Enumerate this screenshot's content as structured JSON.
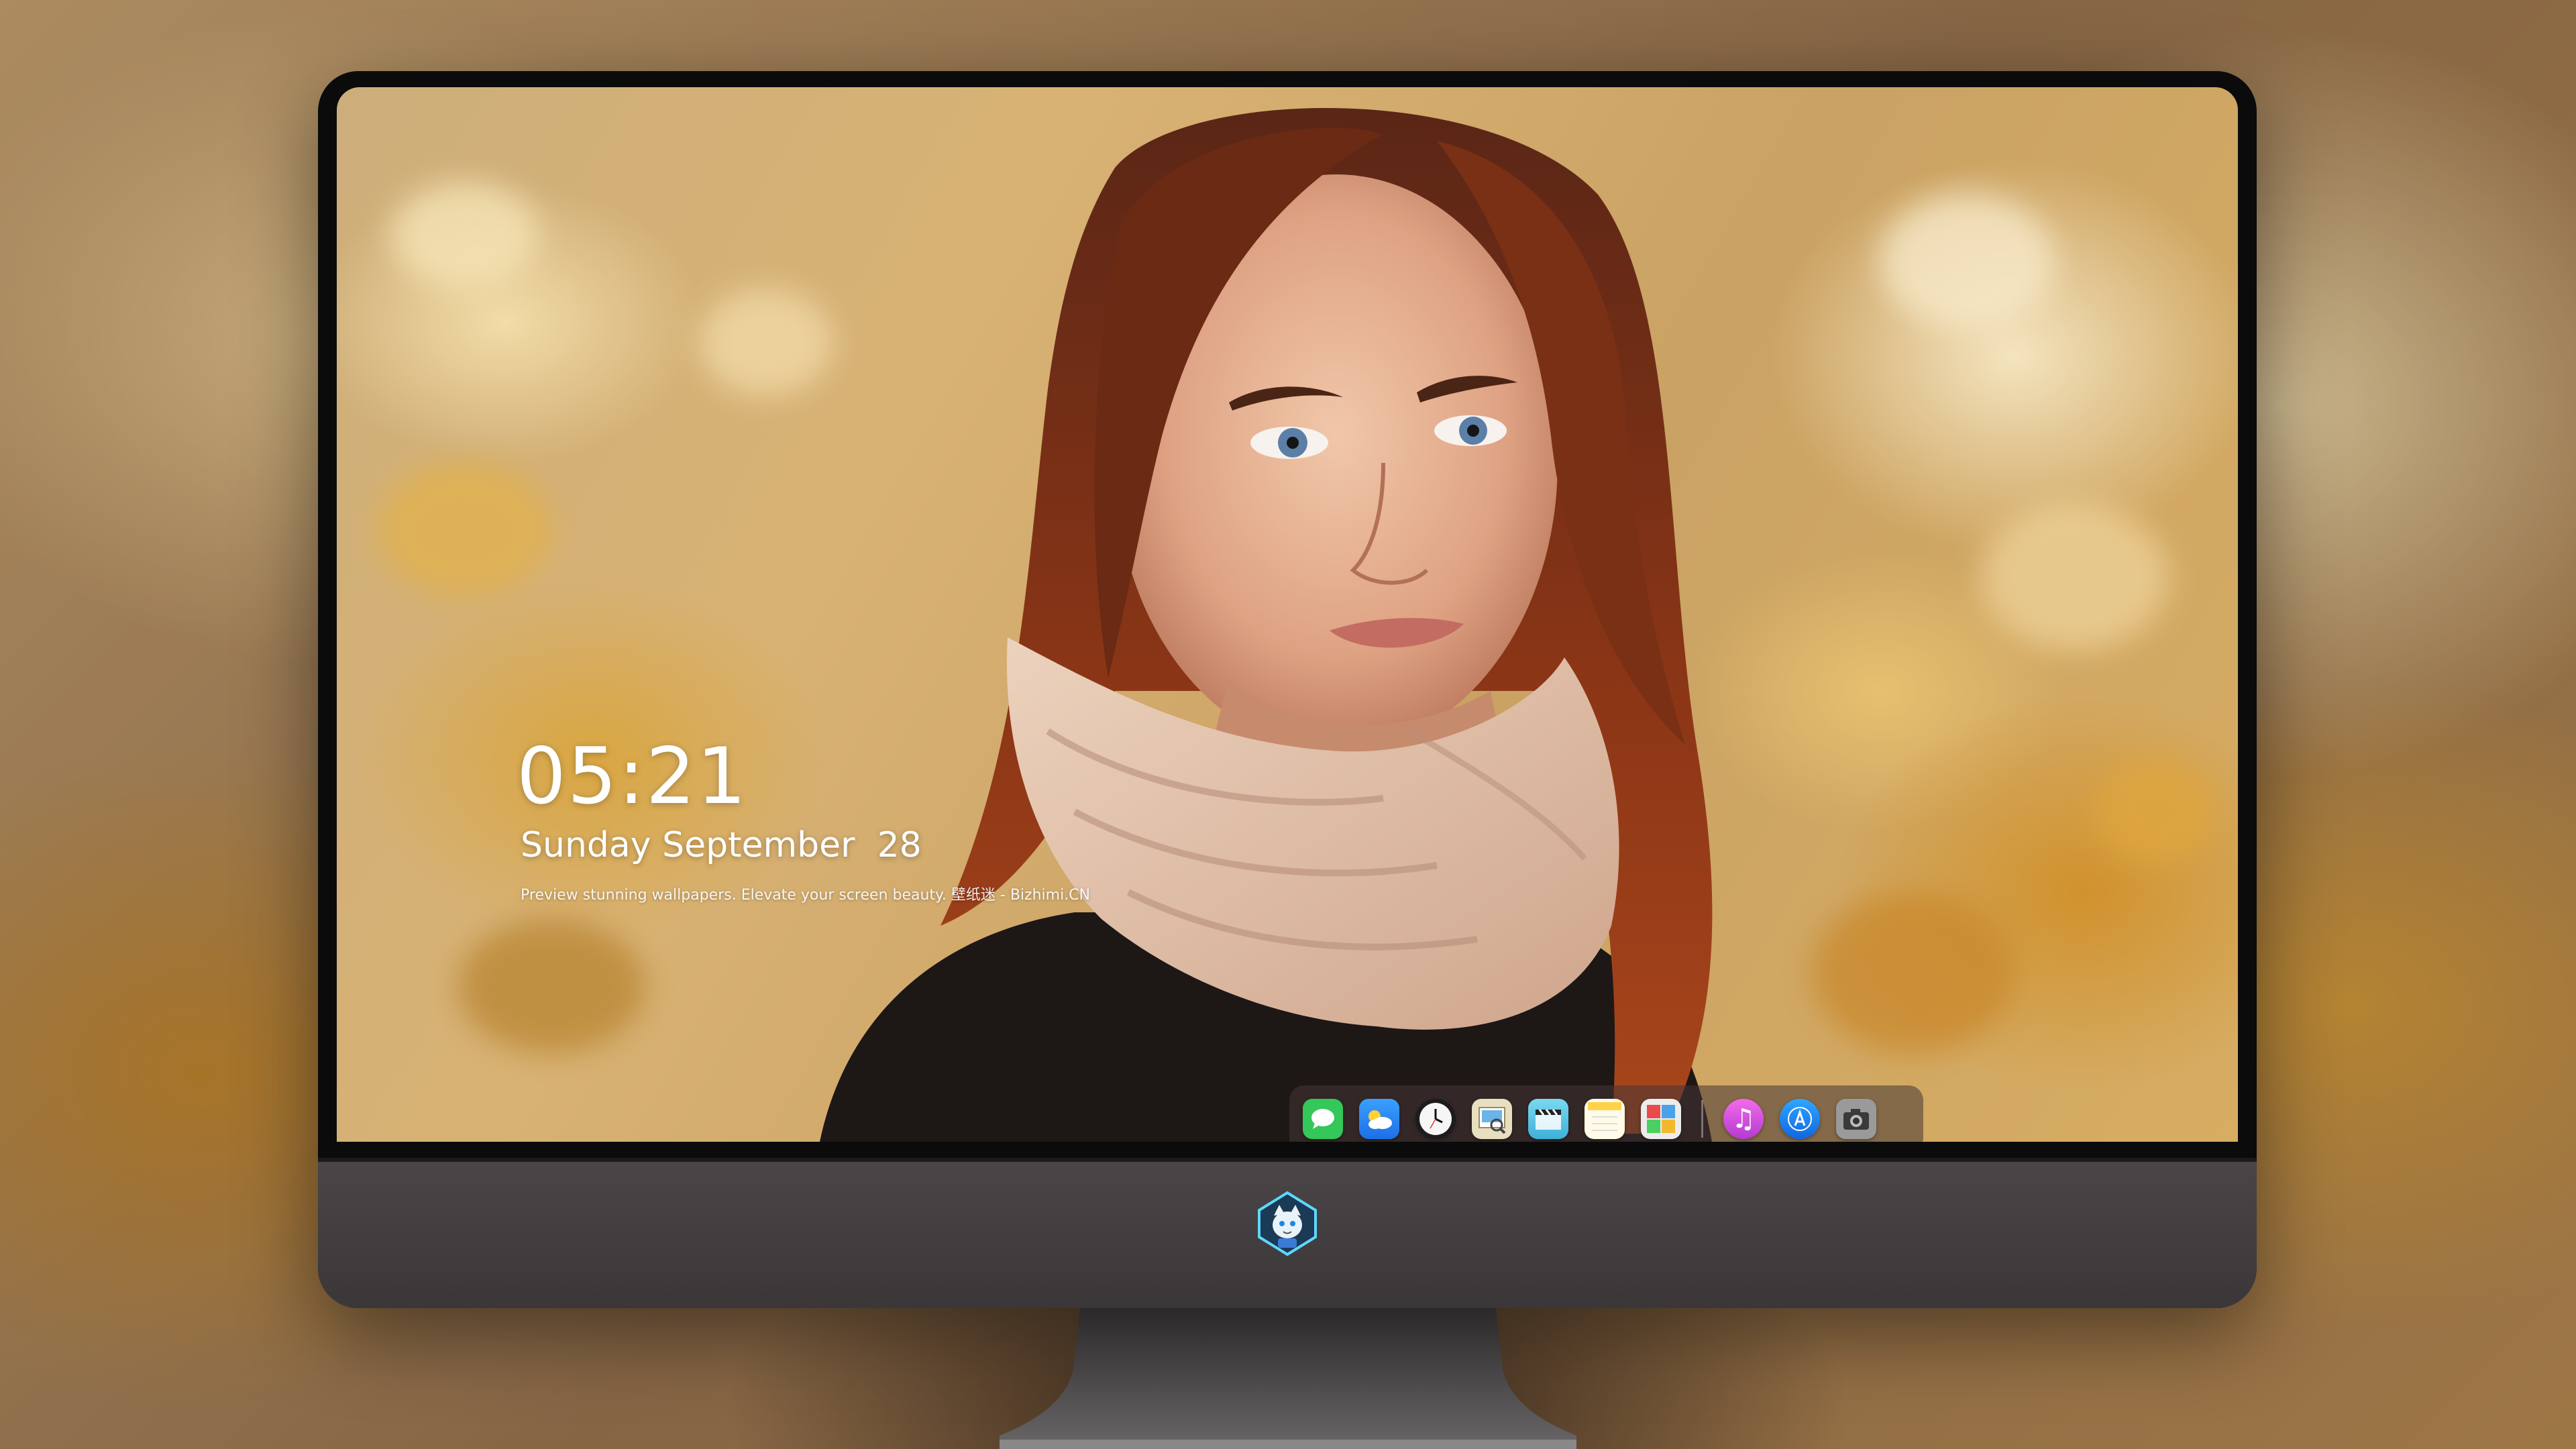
{
  "lockscreen": {
    "time": "05:21",
    "date": "Sunday September  28",
    "caption": "Preview stunning wallpapers. Elevate your screen beauty. 壁纸迷 - Bizhimi.CN"
  },
  "dock": {
    "icons": [
      {
        "name": "messages-icon",
        "glyph": "",
        "color": "#34c759"
      },
      {
        "name": "weather-icon",
        "glyph": "",
        "color": "#2f8cff"
      },
      {
        "name": "clock-icon",
        "glyph": "",
        "color": "#f4f4f4"
      },
      {
        "name": "preview-icon",
        "glyph": "",
        "color": "#e8e2c8"
      },
      {
        "name": "claquette-icon",
        "glyph": "",
        "color": "#5ec8e6"
      },
      {
        "name": "notes-icon",
        "glyph": "",
        "color": "#fffbe8"
      },
      {
        "name": "photo-booth-icon",
        "glyph": "",
        "color": "#ececec"
      },
      {
        "name": "music-icon",
        "glyph": "♫",
        "color": "#d34fd8"
      },
      {
        "name": "app-store-icon",
        "glyph": "A",
        "color": "#1f8fff"
      },
      {
        "name": "camera-icon",
        "glyph": "",
        "color": "#8c8c8c"
      }
    ]
  },
  "brand": {
    "logo_icon": "fox-mascot-logo-icon"
  },
  "colors": {
    "bezel": "#0b0b0c",
    "chin": "#433f41",
    "dock_bg": "rgba(70,55,55,0.55)",
    "time_text": "#ffffff"
  }
}
